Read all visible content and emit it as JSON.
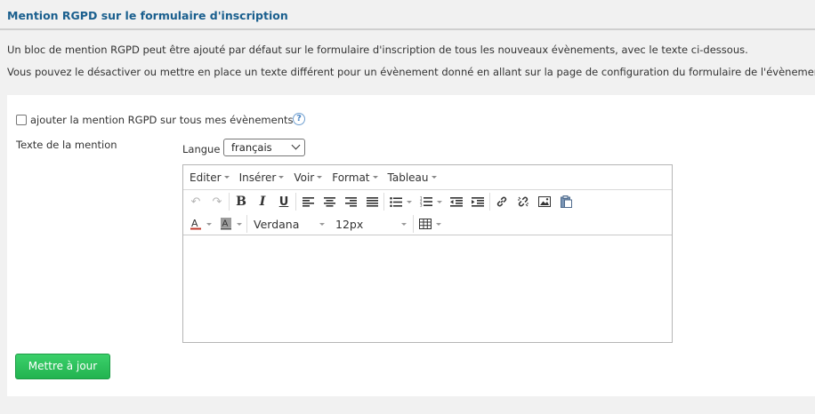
{
  "header": {
    "title": "Mention RGPD sur le formulaire d'inscription",
    "intro_1": "Un bloc de mention RGPD peut être ajouté par défaut sur le formulaire d'inscription de tous les nouveaux évènements, avec le texte ci-dessous.",
    "intro_2": "Vous pouvez le désactiver ou mettre en place un texte différent pour un évènement donné en allant sur la page de configuration du formulaire de l'évènement."
  },
  "form": {
    "checkbox_label": "ajouter la mention RGPD sur tous mes évènements",
    "help": "?",
    "mention_label": "Texte de la mention",
    "langue_label": "Langue",
    "langue_value": "français",
    "submit_label": "Mettre à jour"
  },
  "editor": {
    "menus": [
      "Editer",
      "Insérer",
      "Voir",
      "Format",
      "Tableau"
    ],
    "font_family": "Verdana",
    "font_size": "12px",
    "text_color_glyph": "A",
    "bg_color_glyph": "A",
    "bold": "B",
    "italic": "I",
    "underline": "U"
  },
  "colors": {
    "title": "#1a5f8e",
    "submit_green": "#22b350",
    "text_color_bar": "#c0392b"
  }
}
